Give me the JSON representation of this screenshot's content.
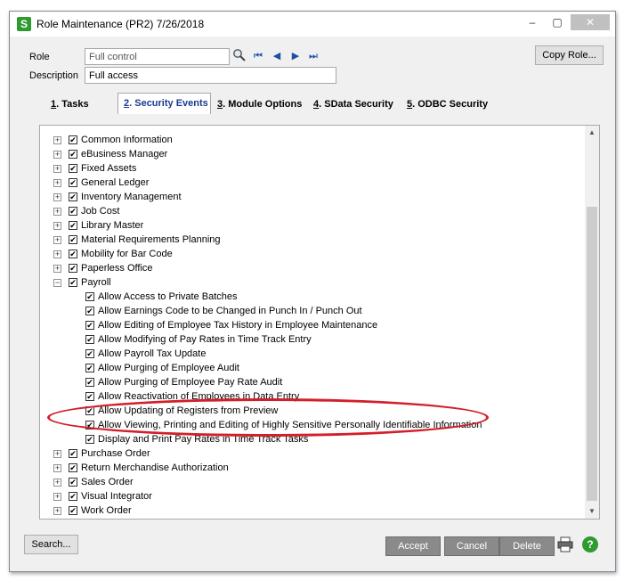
{
  "window": {
    "title": "Role Maintenance (PR2) 7/26/2018",
    "app_icon_letter": "S",
    "minimize": "–",
    "restore": "▢",
    "close": "✕"
  },
  "form": {
    "role_label": "Role",
    "role_placeholder": "Full control",
    "description_label": "Description",
    "description_value": "Full access",
    "copy_role_button": "Copy Role..."
  },
  "navigation": {
    "first": "⏮",
    "previous": "◀",
    "next": "▶",
    "last": "⏭"
  },
  "tabs": [
    {
      "num": "1",
      "label": ". Tasks",
      "active": false
    },
    {
      "num": "2",
      "label": ". Security Events",
      "active": true
    },
    {
      "num": "3",
      "label": ". Module Options",
      "active": false
    },
    {
      "num": "4",
      "label": ". SData Security",
      "active": false
    },
    {
      "num": "5",
      "label": ". ODBC Security",
      "active": false
    }
  ],
  "tree": {
    "top_items_before": [
      "Common Information",
      "eBusiness Manager",
      "Fixed Assets",
      "General Ledger",
      "Inventory Management",
      "Job Cost",
      "Library Master",
      "Material Requirements Planning",
      "Mobility for Bar Code",
      "Paperless Office"
    ],
    "expanded_item": "Payroll",
    "payroll_children": [
      "Allow Access to Private Batches",
      "Allow Earnings Code to be Changed in Punch In / Punch Out",
      "Allow Editing of Employee Tax History in Employee Maintenance",
      "Allow Modifying of Pay Rates in Time Track Entry",
      "Allow Payroll Tax Update",
      "Allow Purging of Employee Audit",
      "Allow Purging of Employee Pay Rate Audit",
      "Allow Reactivation of Employees in Data Entry",
      "Allow Updating of Registers from Preview",
      "Allow Viewing, Printing and Editing of Highly Sensitive Personally Identifiable Information",
      "Display and Print Pay Rates in Time Track Tasks"
    ],
    "top_items_after": [
      "Purchase Order",
      "Return Merchandise Authorization",
      "Sales Order",
      "Visual Integrator",
      "Work Order"
    ],
    "check_glyph": "✔",
    "plus_glyph": "+",
    "minus_glyph": "−"
  },
  "footer": {
    "search_button": "Search...",
    "accept_button": "Accept",
    "cancel_button": "Cancel",
    "delete_button": "Delete",
    "print_icon": "🖶",
    "help_icon": "?"
  },
  "colors": {
    "highlight_oval": "#d21f2a",
    "accent_tab": "#1c3a8c"
  }
}
